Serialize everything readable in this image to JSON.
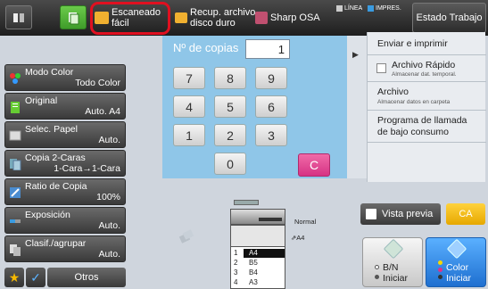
{
  "topbar": {
    "escaneado": "Escaneado fácil",
    "recup": "Recup. archivo disco duro",
    "sharp": "Sharp OSA",
    "linea": "LÍNEA",
    "impres": "IMPRES.",
    "estado": "Estado Trabajo",
    "colors": {
      "linea": "#cccccc",
      "impres": "#3a9be0",
      "highlight": "#e01020"
    }
  },
  "settings": [
    {
      "name": "Modo Color",
      "value": "Todo Color",
      "icon": "color-mode-icon"
    },
    {
      "name": "Original",
      "value": "Auto.  A4",
      "icon": "original-icon"
    },
    {
      "name": "Selec. Papel",
      "value": "Auto.",
      "icon": "paper-select-icon"
    },
    {
      "name": "Copia 2-Caras",
      "value": "1-Cara→1-Cara",
      "icon": "duplex-icon"
    },
    {
      "name": "Ratio de Copia",
      "value": "100%",
      "icon": "ratio-icon"
    },
    {
      "name": "Exposición",
      "value": "Auto.",
      "icon": "exposure-icon"
    },
    {
      "name": "Clasif./agrupar",
      "value": "Auto.",
      "icon": "sort-icon"
    }
  ],
  "bottom_left": {
    "otros": "Otros"
  },
  "keypad": {
    "label": "Nº de copias",
    "value": "1",
    "keys": [
      "7",
      "8",
      "9",
      "4",
      "5",
      "6",
      "1",
      "2",
      "3",
      "0"
    ],
    "clear": "C",
    "background": "#8fc6e8"
  },
  "right_panel": {
    "enviar": "Enviar e imprimir",
    "archivo_rapido": "Archivo Rápido",
    "archivo_rapido_sub": "Almacenar dat. temporal.",
    "archivo": "Archivo",
    "archivo_sub": "Almacenar datos en carpeta",
    "programa": "Programa de llamada de bajo consumo"
  },
  "printer": {
    "output_label": "Normal",
    "feed_label": "A4",
    "trays": [
      {
        "num": "1",
        "size": "A4"
      },
      {
        "num": "2",
        "size": "B5"
      },
      {
        "num": "3",
        "size": "B4"
      },
      {
        "num": "4",
        "size": "A3"
      }
    ]
  },
  "actions": {
    "preview": "Vista previa",
    "ca": "CA",
    "bn": "B/N Iniciar",
    "color": "Color Iniciar"
  }
}
